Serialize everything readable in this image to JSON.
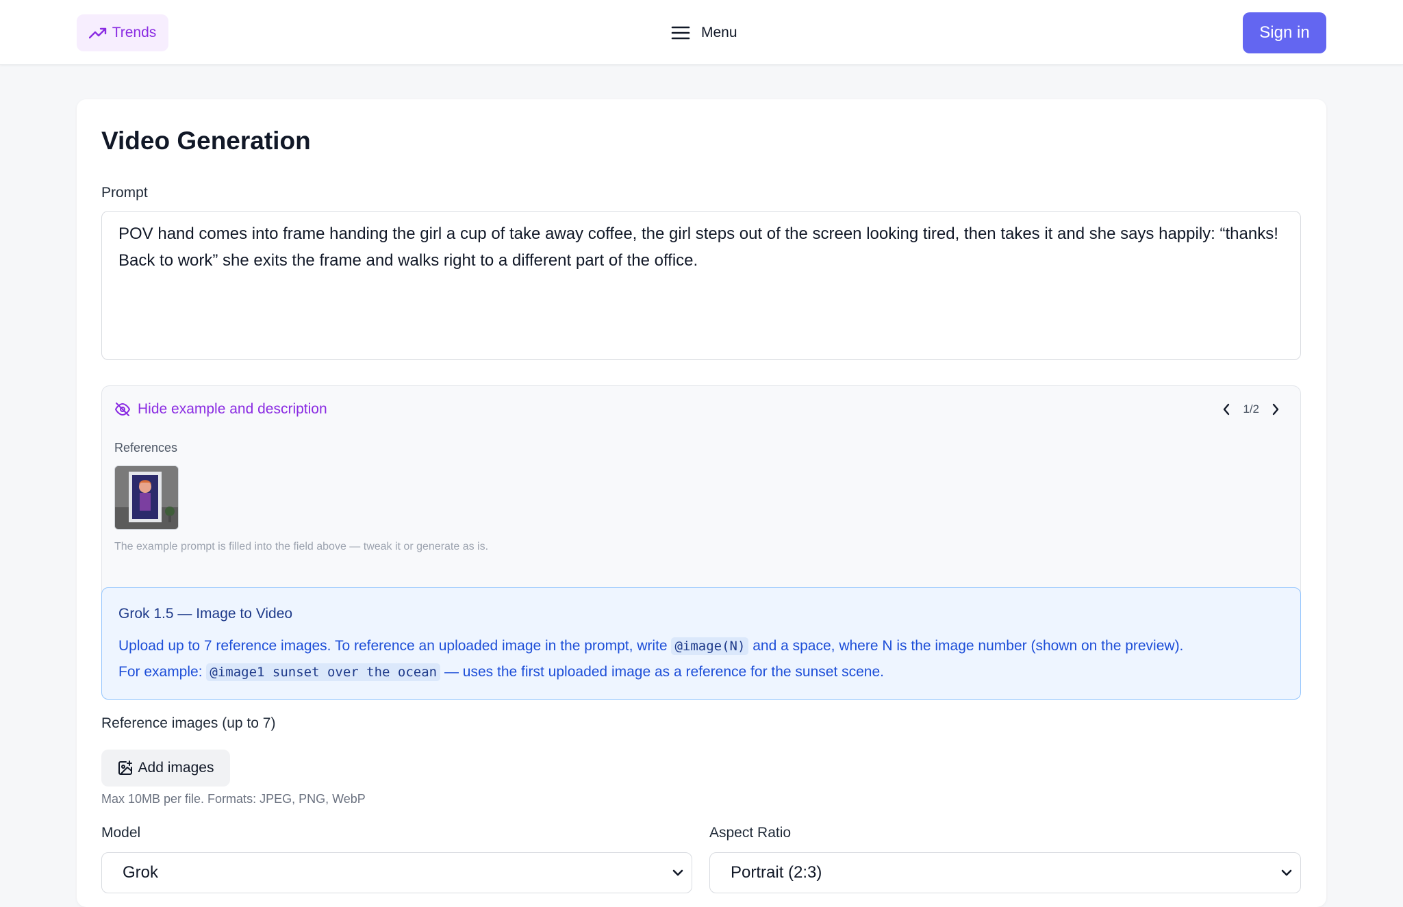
{
  "header": {
    "trends_label": "Trends",
    "menu_label": "Menu",
    "signin_label": "Sign in"
  },
  "page": {
    "title": "Video Generation",
    "prompt_label": "Prompt",
    "prompt_value_line1": "POV hand comes into frame handing the girl a cup of take away coffee, the girl steps out of the screen looking tired, then takes it and she says happily: “thanks!",
    "prompt_value_line2": "Back to work” she exits the frame and walks right to a different part of the office."
  },
  "example": {
    "hide_label": "Hide example and description",
    "pager": "1/2",
    "references_label": "References",
    "note": "The example prompt is filled into the field above — tweak it or generate as is."
  },
  "info": {
    "title": "Grok 1.5 — Image to Video",
    "line1_pre": "Upload up to 7 reference images. To reference an uploaded image in the prompt, write",
    "line1_code": "@image(N)",
    "line1_post": "and a space, where N is the image number (shown on the preview).",
    "line2_pre": "For example:",
    "line2_code": "@image1 sunset over the ocean",
    "line2_post": "— uses the first uploaded image as a reference for the sunset scene."
  },
  "uploads": {
    "label": "Reference images (up to 7)",
    "add_label": "Add images",
    "hint": "Max 10MB per file. Formats: JPEG, PNG, WebP"
  },
  "settings": {
    "model_label": "Model",
    "model_value": "Grok",
    "aspect_label": "Aspect Ratio",
    "aspect_value": "Portrait (2:3)"
  },
  "colors": {
    "accent": "#6366f1",
    "purple": "#8a2be2",
    "info_bg": "#eef5ff",
    "info_border": "#93c5fd"
  }
}
